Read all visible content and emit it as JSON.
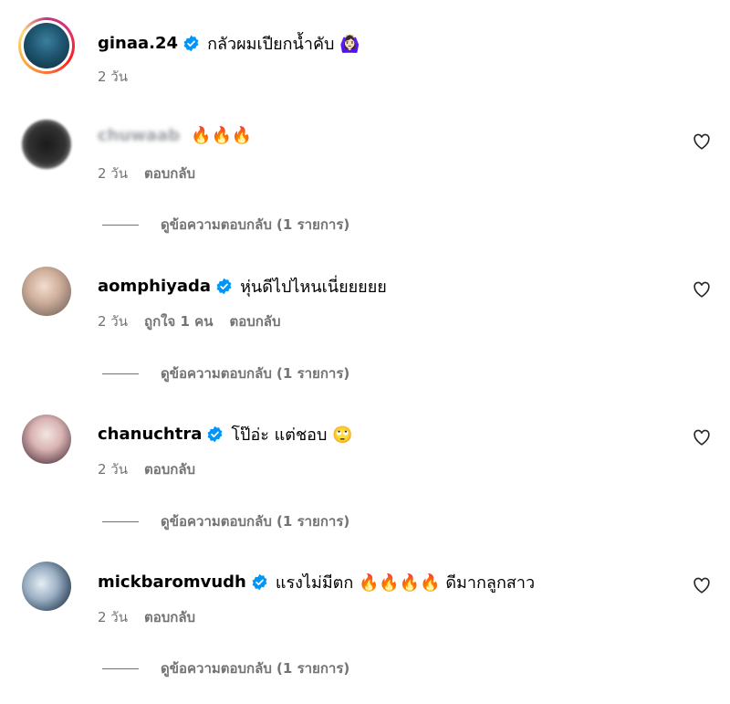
{
  "colors": {
    "verified_blue": "#0095f6",
    "meta_gray": "#737373",
    "text": "#000000"
  },
  "comments": [
    {
      "username": "ginaa.24",
      "verified": true,
      "text": "กลัวผมเปียกน้ำคับ 🙆🏻‍♀️",
      "time": "2 วัน",
      "story_ring": true
    },
    {
      "username": "chuwaab",
      "username_blurred": true,
      "verified": false,
      "text": "🔥🔥🔥",
      "time": "2 วัน",
      "reply_label": "ตอบกลับ",
      "view_replies": "ดูข้อความตอบกลับ (1 รายการ)"
    },
    {
      "username": "aomphiyada",
      "verified": true,
      "text": "หุ่นดีไปไหนเนี่ยยยยย",
      "time": "2 วัน",
      "likes": "ถูกใจ 1 คน",
      "reply_label": "ตอบกลับ",
      "view_replies": "ดูข้อความตอบกลับ (1 รายการ)"
    },
    {
      "username": "chanuchtra",
      "verified": true,
      "text": "โป๊อ่ะ แต่ชอบ 🙄",
      "time": "2 วัน",
      "reply_label": "ตอบกลับ",
      "view_replies": "ดูข้อความตอบกลับ (1 รายการ)"
    },
    {
      "username": "mickbaromvudh",
      "verified": true,
      "text": "แรงไม่มีตก 🔥🔥🔥🔥 ดีมากลูกสาว",
      "time": "2 วัน",
      "reply_label": "ตอบกลับ",
      "view_replies": "ดูข้อความตอบกลับ (1 รายการ)"
    }
  ],
  "icons": {
    "verified": "verified-badge-icon",
    "like": "heart-outline-icon"
  }
}
